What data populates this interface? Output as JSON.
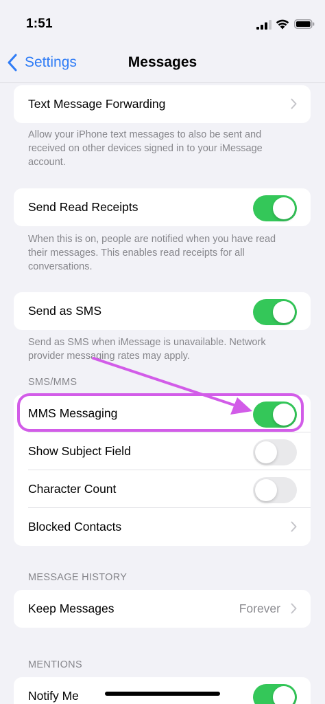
{
  "status": {
    "time": "1:51"
  },
  "nav": {
    "back_label": "Settings",
    "title": "Messages"
  },
  "groups": {
    "forwarding": {
      "label": "Text Message Forwarding",
      "note": "Allow your iPhone text messages to also be sent and received on other devices signed in to your iMessage account."
    },
    "read_receipts": {
      "label": "Send Read Receipts",
      "on": true,
      "note": "When this is on, people are notified when you have read their messages. This enables read receipts for all conversations."
    },
    "send_sms": {
      "label": "Send as SMS",
      "on": true,
      "note": "Send as SMS when iMessage is unavailable. Network provider messaging rates may apply."
    },
    "sms_mms": {
      "header": "SMS/MMS",
      "mms": {
        "label": "MMS Messaging",
        "on": true
      },
      "subject": {
        "label": "Show Subject Field",
        "on": false
      },
      "char_count": {
        "label": "Character Count",
        "on": false
      },
      "blocked": {
        "label": "Blocked Contacts"
      }
    },
    "history": {
      "header": "MESSAGE HISTORY",
      "keep": {
        "label": "Keep Messages",
        "value": "Forever"
      }
    },
    "mentions": {
      "header": "MENTIONS",
      "notify": {
        "label": "Notify Me",
        "on": true
      }
    }
  },
  "colors": {
    "accent": "#2f7cf6",
    "toggle_on": "#34c759",
    "annotation": "#d25ce8"
  }
}
